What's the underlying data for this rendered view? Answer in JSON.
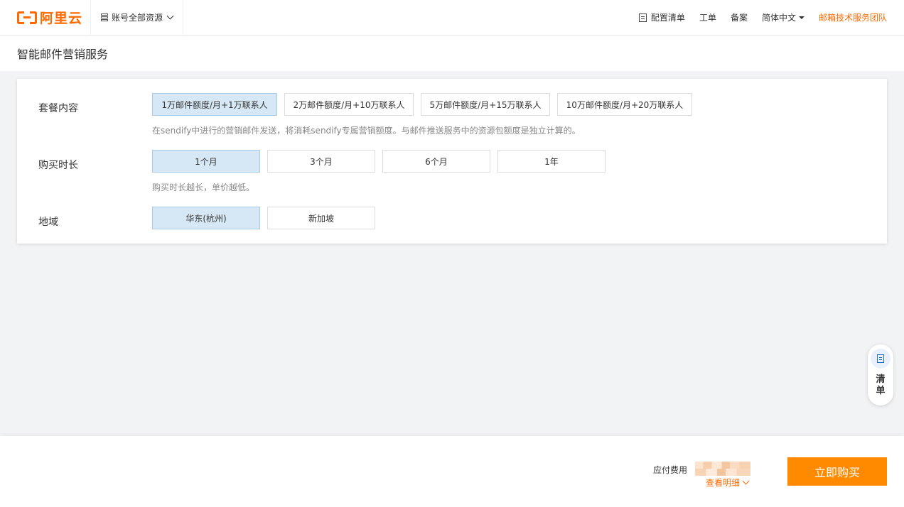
{
  "header": {
    "logo_text": "阿里云",
    "resources_label": "账号全部资源",
    "nav": {
      "config_list": "配置清单",
      "ticket": "工单",
      "filing": "备案",
      "language": "简体中文",
      "team": "邮箱技术服务团队"
    }
  },
  "page": {
    "title": "智能邮件营销服务"
  },
  "config": {
    "package": {
      "label": "套餐内容",
      "options": [
        "1万邮件额度/月+1万联系人",
        "2万邮件额度/月+10万联系人",
        "5万邮件额度/月+15万联系人",
        "10万邮件额度/月+20万联系人"
      ],
      "selected_index": 0,
      "hint": "在sendify中进行的营销邮件发送，将消耗sendify专属营销额度。与邮件推送服务中的资源包额度是独立计算的。"
    },
    "duration": {
      "label": "购买时长",
      "options": [
        "1个月",
        "3个月",
        "6个月",
        "1年"
      ],
      "selected_index": 0,
      "hint": "购买时长越长，单价越低。"
    },
    "region": {
      "label": "地域",
      "options": [
        "华东(杭州)",
        "新加坡"
      ],
      "selected_index": 0
    }
  },
  "float_cart": {
    "label": "清单"
  },
  "footer": {
    "fee_label": "应付费用",
    "detail_link": "查看明细",
    "buy_button": "立即购买"
  },
  "colors": {
    "brand": "#ff6a00",
    "buy_button": "#ff8a00",
    "selected_bg": "#d6e8f5"
  }
}
